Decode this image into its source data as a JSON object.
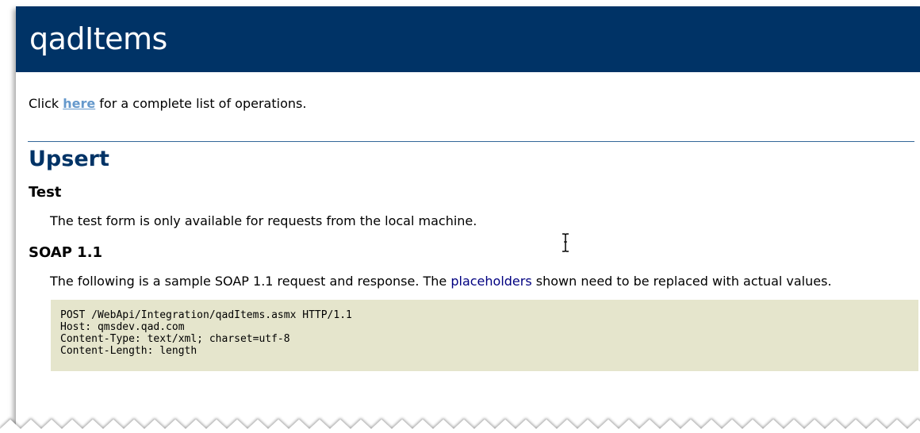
{
  "header": {
    "service_name": "qadItems"
  },
  "intro": {
    "prefix": "Click ",
    "link_label": "here",
    "suffix": " for a complete list of operations."
  },
  "operation": {
    "name": "Upsert"
  },
  "test_section": {
    "heading": "Test",
    "text": "The test form is only available for requests from the local machine."
  },
  "soap_section": {
    "heading": "SOAP 1.1",
    "text_before": "The following is a sample SOAP 1.1 request and response. The ",
    "link_label": "placeholders",
    "text_after": " shown need to be replaced with actual values.",
    "code_lines": [
      "POST /WebApi/Integration/qadItems.asmx HTTP/1.1",
      "Host: qmsdev.qad.com",
      "Content-Type: text/xml; charset=utf-8",
      "Content-Length: length"
    ]
  },
  "colors": {
    "header_bg": "#003366",
    "operation_title": "#003366",
    "intro_link": "#6699cc",
    "placeholders_link": "#000080",
    "code_bg": "#e5e5cc"
  },
  "icons": {
    "cursor": "text-cursor-icon"
  }
}
